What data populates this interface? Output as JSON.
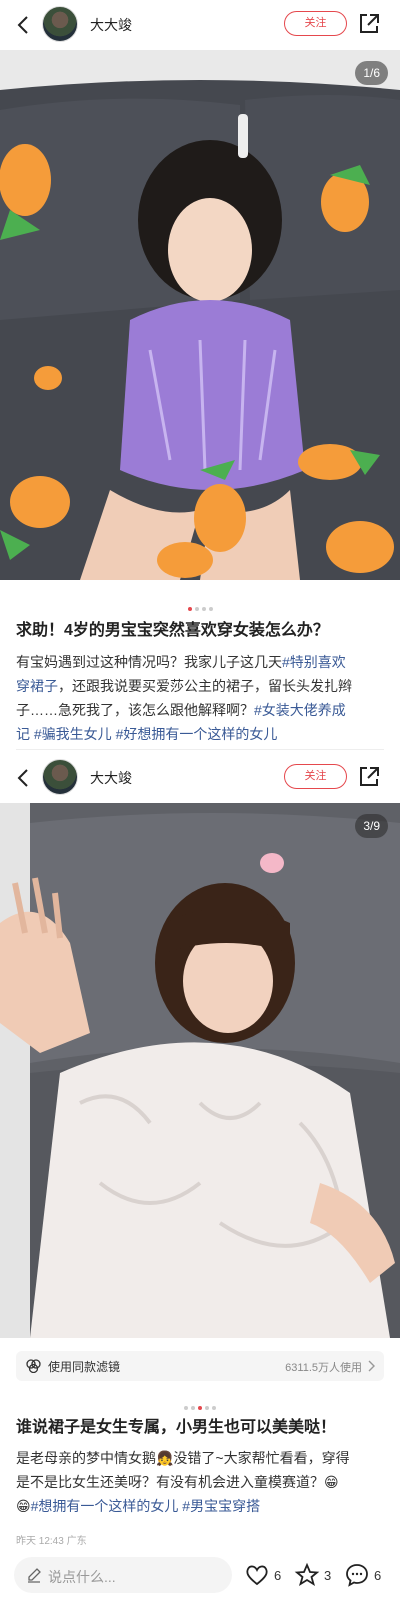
{
  "post1": {
    "author": "大大竣",
    "follow_label": "关注",
    "counter": "1/6",
    "title": "求助！4岁的男宝宝突然喜欢穿女装怎么办？",
    "body_line1": "有宝妈遇到过这种情况吗？我家儿子这几天",
    "body_tag1": "#特别喜欢",
    "body_line2_tag": "穿裙子",
    "body_line2": "，还跟我说要买爱莎公主的裙子，留长头发扎辫",
    "body_line3": "子……急死我了，该怎么跟他解释啊？",
    "body_tag2": "#女装大佬养成",
    "body_tag2b": "记",
    "body_tag3": "#骗我生女儿",
    "body_tag4": "#好想拥有一个这样的女儿"
  },
  "post2": {
    "author": "大大竣",
    "follow_label": "关注",
    "counter": "3/9",
    "filter_label": "使用同款滤镜",
    "filter_count": "6311.5万人使用",
    "title": "谁说裙子是女生专属，小男生也可以美美哒！",
    "body_line1": "是老母亲的梦中情女鹅👧没错了~大家帮忙看看，穿得",
    "body_line2": "是不是比女生还美呀？有没有机会进入童模赛道？😁",
    "body_line3_emoji": "😁",
    "body_tag1": "#想拥有一个这样的女儿",
    "body_tag2": "#男宝宝穿搭",
    "meta": "昨天 12:43  广东"
  },
  "bottombar": {
    "comment_placeholder": "说点什么...",
    "likes": "6",
    "favorites": "3",
    "comments": "6"
  },
  "icons": [
    "back-arrow-icon",
    "share-icon",
    "filter-icon",
    "chevron-right-icon",
    "pen-icon",
    "heart-icon",
    "star-icon",
    "comment-icon"
  ],
  "colors": {
    "accent": "#e5484d",
    "tag": "#3a5a96"
  }
}
